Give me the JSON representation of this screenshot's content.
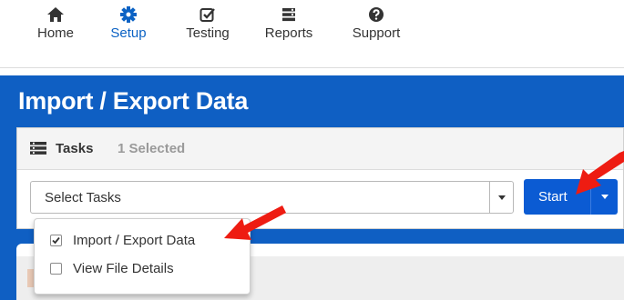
{
  "nav": {
    "items": [
      {
        "label": "Home",
        "icon": "home-icon"
      },
      {
        "label": "Setup",
        "icon": "gear-icon",
        "active": true
      },
      {
        "label": "Testing",
        "icon": "checkbox-icon"
      },
      {
        "label": "Reports",
        "icon": "report-icon"
      },
      {
        "label": "Support",
        "icon": "question-icon"
      }
    ]
  },
  "page": {
    "title": "Import / Export Data"
  },
  "tasks": {
    "label": "Tasks",
    "count": "1 Selected",
    "select_text": "Select Tasks",
    "start_label": "Start",
    "options": [
      {
        "label": "Import / Export Data",
        "checked": true
      },
      {
        "label": "View File Details",
        "checked": false
      }
    ]
  },
  "colors": {
    "brand_blue": "#0f5fc3",
    "button_blue": "#0b5bd3",
    "active_nav": "#0b62c4",
    "arrow_red": "#ee1c12"
  }
}
